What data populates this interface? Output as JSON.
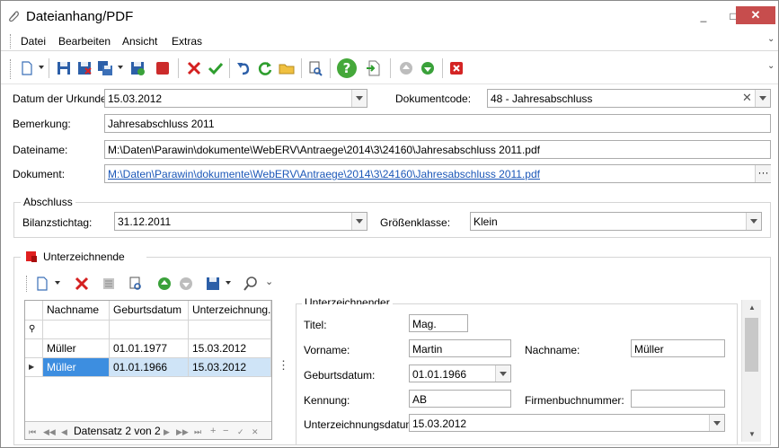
{
  "window": {
    "title": "Dateianhang/PDF"
  },
  "titlebar": {
    "minimize": "_",
    "maximize": "□",
    "close": "✕"
  },
  "menu": [
    "Datei",
    "Bearbeiten",
    "Ansicht",
    "Extras"
  ],
  "form": {
    "datum_label": "Datum der Urkunde:",
    "datum_value": "15.03.2012",
    "dokumentcode_label": "Dokumentcode:",
    "dokumentcode_value": "48 - Jahresabschluss",
    "bemerkung_label": "Bemerkung:",
    "bemerkung_value": "Jahresabschluss 2011",
    "dateiname_label": "Dateiname:",
    "dateiname_value": "M:\\Daten\\Parawin\\dokumente\\WebERV\\Antraege\\2014\\3\\24160\\Jahresabschluss 2011.pdf",
    "dokument_label": "Dokument:",
    "dokument_value": "M:\\Daten\\Parawin\\dokumente\\WebERV\\Antraege\\2014\\3\\24160\\Jahresabschluss 2011.pdf",
    "ellipsis": "···"
  },
  "abschluss": {
    "title": "Abschluss",
    "bilanz_label": "Bilanzstichtag:",
    "bilanz_value": "31.12.2011",
    "groesse_label": "Größenklasse:",
    "groesse_value": "Klein"
  },
  "unterzeichnende": {
    "title": "Unterzeichnende",
    "grid": {
      "columns": [
        "Nachname",
        "Geburtsdatum",
        "Unterzeichnung..."
      ],
      "filter_icon": "⚲",
      "rows": [
        [
          "Müller",
          "01.01.1977",
          "15.03.2012"
        ],
        [
          "Müller",
          "01.01.1966",
          "15.03.2012"
        ]
      ],
      "nav_text": "Datensatz 2 von 2"
    },
    "detail": {
      "title": "Unterzeichnender",
      "titel_label": "Titel:",
      "titel_value": "Mag.",
      "vorname_label": "Vorname:",
      "vorname_value": "Martin",
      "nachname_label": "Nachname:",
      "nachname_value": "Müller",
      "geburtsdatum_label": "Geburtsdatum:",
      "geburtsdatum_value": "01.01.1966",
      "kennung_label": "Kennung:",
      "kennung_value": "AB",
      "firmenbuch_label": "Firmenbuchnummer:",
      "firmenbuch_value": "",
      "unterzeichnungsdatum_label": "Unterzeichnungsdatum:",
      "unterzeichnungsdatum_value": "15.03.2012"
    }
  },
  "colors": {
    "link": "#1b57b8",
    "selected_row": "#cfe4f7",
    "close_button": "#c74d4d",
    "accent_red": "#e02020",
    "accent_green": "#3aa13a"
  }
}
